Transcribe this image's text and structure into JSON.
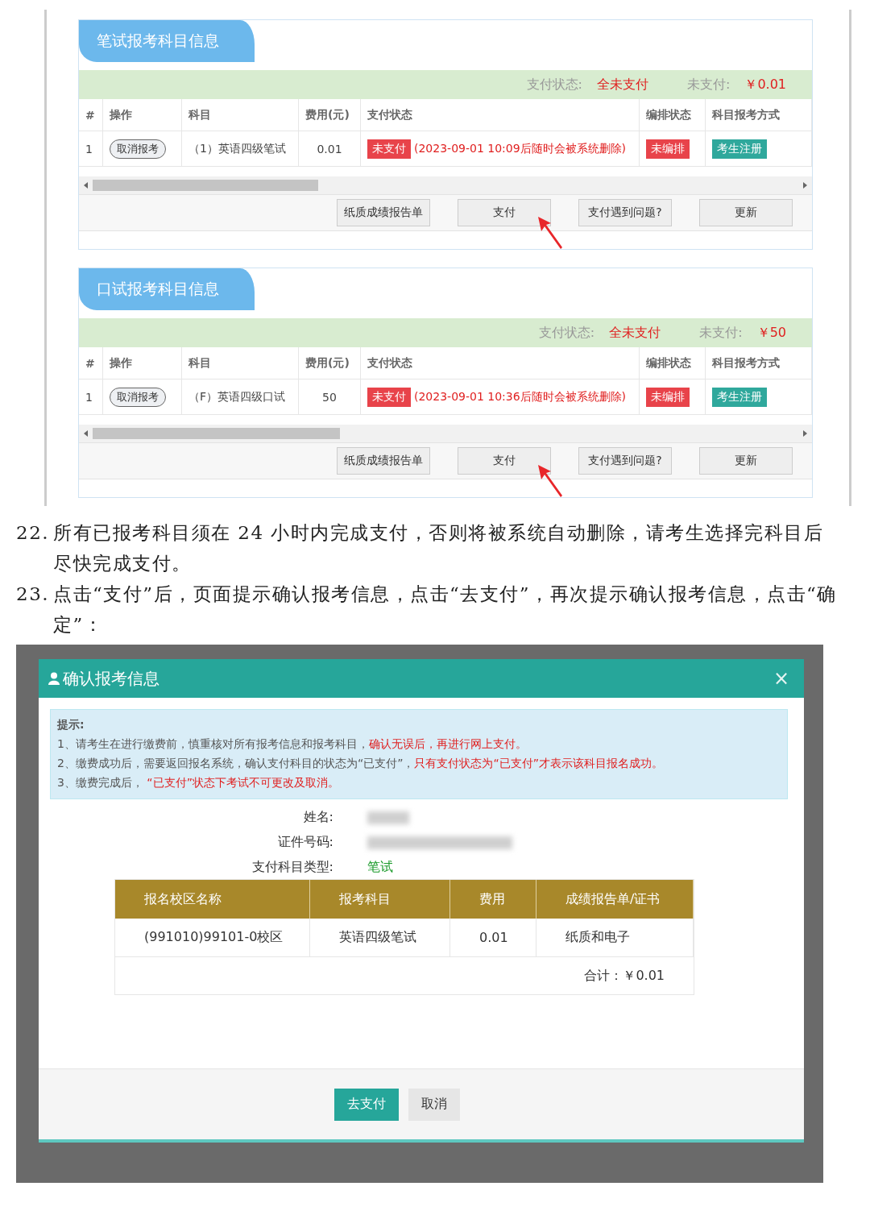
{
  "sections": [
    {
      "title": "笔试报考科目信息",
      "summary": {
        "status_label": "支付状态:",
        "status": "全未支付",
        "unpaid_label": "未支付:",
        "unpaid": "￥0.01"
      },
      "columns": [
        "#",
        "操作",
        "科目",
        "费用(元)",
        "支付状态",
        "编排状态",
        "科目报考方式"
      ],
      "rows": [
        {
          "index": "1",
          "action": "取消报考",
          "subject": "（1）英语四级笔试",
          "fee": "0.01",
          "pay_status": "未支付",
          "pay_note": "(2023-09-01 10:09后随时会被系统删除)",
          "arrange_status": "未编排",
          "method": "考生注册"
        }
      ],
      "buttons": [
        {
          "label": "纸质成绩报告单",
          "pointed": false
        },
        {
          "label": "支付",
          "pointed": true
        },
        {
          "label": "支付遇到问题?",
          "pointed": false
        },
        {
          "label": "更新",
          "pointed": false
        }
      ]
    },
    {
      "title": "口试报考科目信息",
      "summary": {
        "status_label": "支付状态:",
        "status": "全未支付",
        "unpaid_label": "未支付:",
        "unpaid": "￥50"
      },
      "columns": [
        "#",
        "操作",
        "科目",
        "费用(元)",
        "支付状态",
        "编排状态",
        "科目报考方式"
      ],
      "rows": [
        {
          "index": "1",
          "action": "取消报考",
          "subject": "（F）英语四级口试",
          "fee": "50",
          "pay_status": "未支付",
          "pay_note": "(2023-09-01 10:36后随时会被系统删除)",
          "arrange_status": "未编排",
          "method": "考生注册"
        }
      ],
      "buttons": [
        {
          "label": "纸质成绩报告单",
          "pointed": false
        },
        {
          "label": "支付",
          "pointed": true
        },
        {
          "label": "支付遇到问题?",
          "pointed": false
        },
        {
          "label": "更新",
          "pointed": false
        }
      ]
    }
  ],
  "steps": [
    {
      "number": "22.",
      "text": "所有已报考科目须在 24 小时内完成支付，否则将被系统自动删除，请考生选择完科目后尽快完成支付。"
    },
    {
      "number": "23.",
      "text": "点击“支付”后，页面提示确认报考信息，点击“去支付”，再次提示确认报考信息，点击“确定”："
    }
  ],
  "dialog": {
    "title": "确认报考信息",
    "close": "×",
    "notice": {
      "heading": "提示:",
      "lines": [
        [
          {
            "text": "1、请考生在进行缴费前，慎重核对所有报考信息和报考科目，",
            "red": false
          },
          {
            "text": "确认无误后，再进行网上支付。",
            "red": true
          }
        ],
        [
          {
            "text": "2、缴费成功后，需要返回报名系统，确认支付科目的状态为“已支付”，",
            "red": false
          },
          {
            "text": "只有支付状态为“已支付”才表示该科目报名成功。",
            "red": true
          }
        ],
        [
          {
            "text": "3、缴费完成后，",
            "red": false
          },
          {
            "text": " “已支付”状态下考试不可更改及取消。",
            "red": true
          }
        ]
      ]
    },
    "fields": [
      {
        "label": "姓名:",
        "kind": "redacted"
      },
      {
        "label": "证件号码:",
        "kind": "redacted"
      },
      {
        "label": "支付科目类型:",
        "kind": "text",
        "value": "笔试"
      }
    ],
    "table": {
      "columns": [
        "报名校区名称",
        "报考科目",
        "费用",
        "成绩报告单/证书"
      ],
      "rows": [
        [
          "(991010)99101-0校区",
          "英语四级笔试",
          "0.01",
          "纸质和电子"
        ]
      ],
      "total": "合计：￥0.01"
    },
    "buttons": [
      {
        "label": "去支付",
        "primary": true
      },
      {
        "label": "取消",
        "primary": false
      }
    ]
  }
}
